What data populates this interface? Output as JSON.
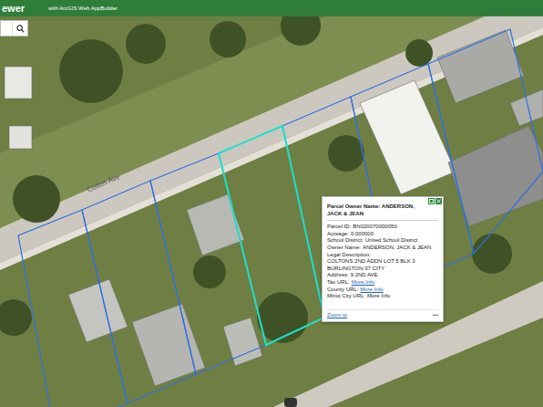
{
  "header": {
    "title": "ewer",
    "subtitle": "with ArcGIS Web AppBuilder"
  },
  "map": {
    "road_label": "Colton Ave"
  },
  "popup": {
    "title": "Parcel Owner Name: ANDERSON, JACK & JEAN",
    "fields": [
      {
        "label": "Parcel ID:",
        "value": "BN020070000050",
        "kind": "text"
      },
      {
        "label": "Acreage:",
        "value": "0.000000",
        "kind": "text"
      },
      {
        "label": "School District:",
        "value": "United School District",
        "kind": "text"
      },
      {
        "label": "Owner Name:",
        "value": "ANDERSON, JACK & JEAN",
        "kind": "text"
      },
      {
        "label": "Legal Description:",
        "value": "COLTONS 2ND ADDN LOT 5 BLK 3 BURLINGTON-37 CITY",
        "kind": "block"
      },
      {
        "label": "Address:",
        "value": "9 2ND AVE",
        "kind": "text"
      },
      {
        "label": "Tax URL:",
        "value": "More Info",
        "kind": "link"
      },
      {
        "label": "County URL:",
        "value": "More Info",
        "kind": "link"
      },
      {
        "label": "Minot City URL:",
        "value": "More Info",
        "kind": "text"
      }
    ],
    "zoom_link": "Zoom to",
    "more": "•••"
  }
}
